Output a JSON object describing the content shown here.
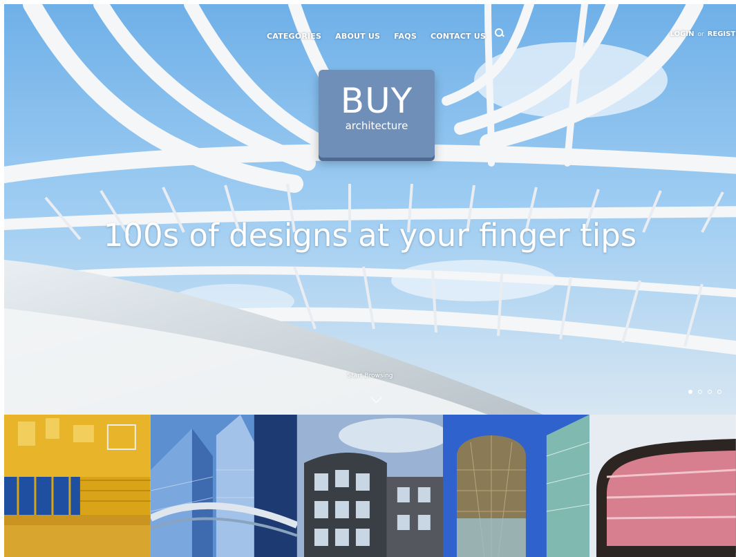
{
  "nav": {
    "items": [
      {
        "label": "CATEGORIES"
      },
      {
        "label": "ABOUT US"
      },
      {
        "label": "FAQS"
      },
      {
        "label": "CONTACT US"
      }
    ],
    "search_icon": "search-icon"
  },
  "auth": {
    "login": "LOGIN",
    "or": "or",
    "register": "REGISTE"
  },
  "logo": {
    "big": "BUY",
    "small": "architecture"
  },
  "hero": {
    "headline": "100s of designs at your finger tips",
    "browse": "Start Browsing",
    "chevron_icon": "chevron-down-icon",
    "slide_dots": 4,
    "active_dot": 1
  },
  "thumbnails": [
    {
      "name": "gym-interior",
      "palette": [
        "#d9a418",
        "#1f4fa0"
      ]
    },
    {
      "name": "glass-towers",
      "palette": [
        "#4f7fc2",
        "#1a3060"
      ]
    },
    {
      "name": "glass-building",
      "palette": [
        "#9ab3d4",
        "#3a3e45"
      ]
    },
    {
      "name": "dome-building",
      "palette": [
        "#3b6bd6",
        "#8a7a55"
      ]
    },
    {
      "name": "curved-building",
      "palette": [
        "#c86478",
        "#2c2522"
      ]
    }
  ],
  "colors": {
    "logo_bg": "#6f8fb9",
    "sky": "#8fc3ee",
    "text": "#ffffff"
  }
}
